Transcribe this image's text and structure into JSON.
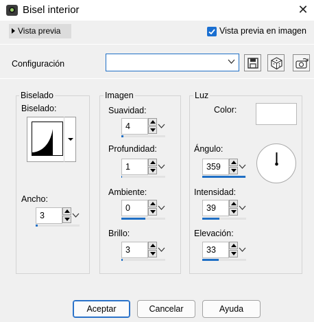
{
  "window": {
    "title": "Bisel interior",
    "close_glyph": "✕",
    "icon": "app-camera-icon"
  },
  "preview": {
    "toggle_label": "Vista previa",
    "checkbox_label": "Vista previa en imagen",
    "checked": true
  },
  "config": {
    "label": "Configuración",
    "value": ""
  },
  "toolbar": {
    "icons": [
      "save-icon",
      "dice-icon",
      "camera-preset-icon"
    ]
  },
  "groups": {
    "bevel": {
      "title": "Biselado",
      "label": "Biselado:",
      "width": {
        "label": "Ancho:",
        "value": "3",
        "slider": 0.05
      }
    },
    "image": {
      "title": "Imagen",
      "smoothness": {
        "label": "Suavidad:",
        "value": "4",
        "slider": 0.04
      },
      "depth": {
        "label": "Profundidad:",
        "value": "1",
        "slider": 0.02
      },
      "ambience": {
        "label": "Ambiente:",
        "value": "0",
        "slider": 0.55
      },
      "brightness": {
        "label": "Brillo:",
        "value": "3",
        "slider": 0.03
      }
    },
    "light": {
      "title": "Luz",
      "color": {
        "label": "Color:",
        "value": "#ffffff"
      },
      "angle": {
        "label": "Ángulo:",
        "value": "359",
        "slider": 0.99
      },
      "intensity": {
        "label": "Intensidad:",
        "value": "39",
        "slider": 0.39
      },
      "elevation": {
        "label": "Elevación:",
        "value": "33",
        "slider": 0.37
      }
    }
  },
  "buttons": {
    "ok": "Aceptar",
    "cancel": "Cancelar",
    "help": "Ayuda"
  },
  "colors": {
    "accent": "#1f6fc5",
    "background": "#f0f0f0"
  }
}
